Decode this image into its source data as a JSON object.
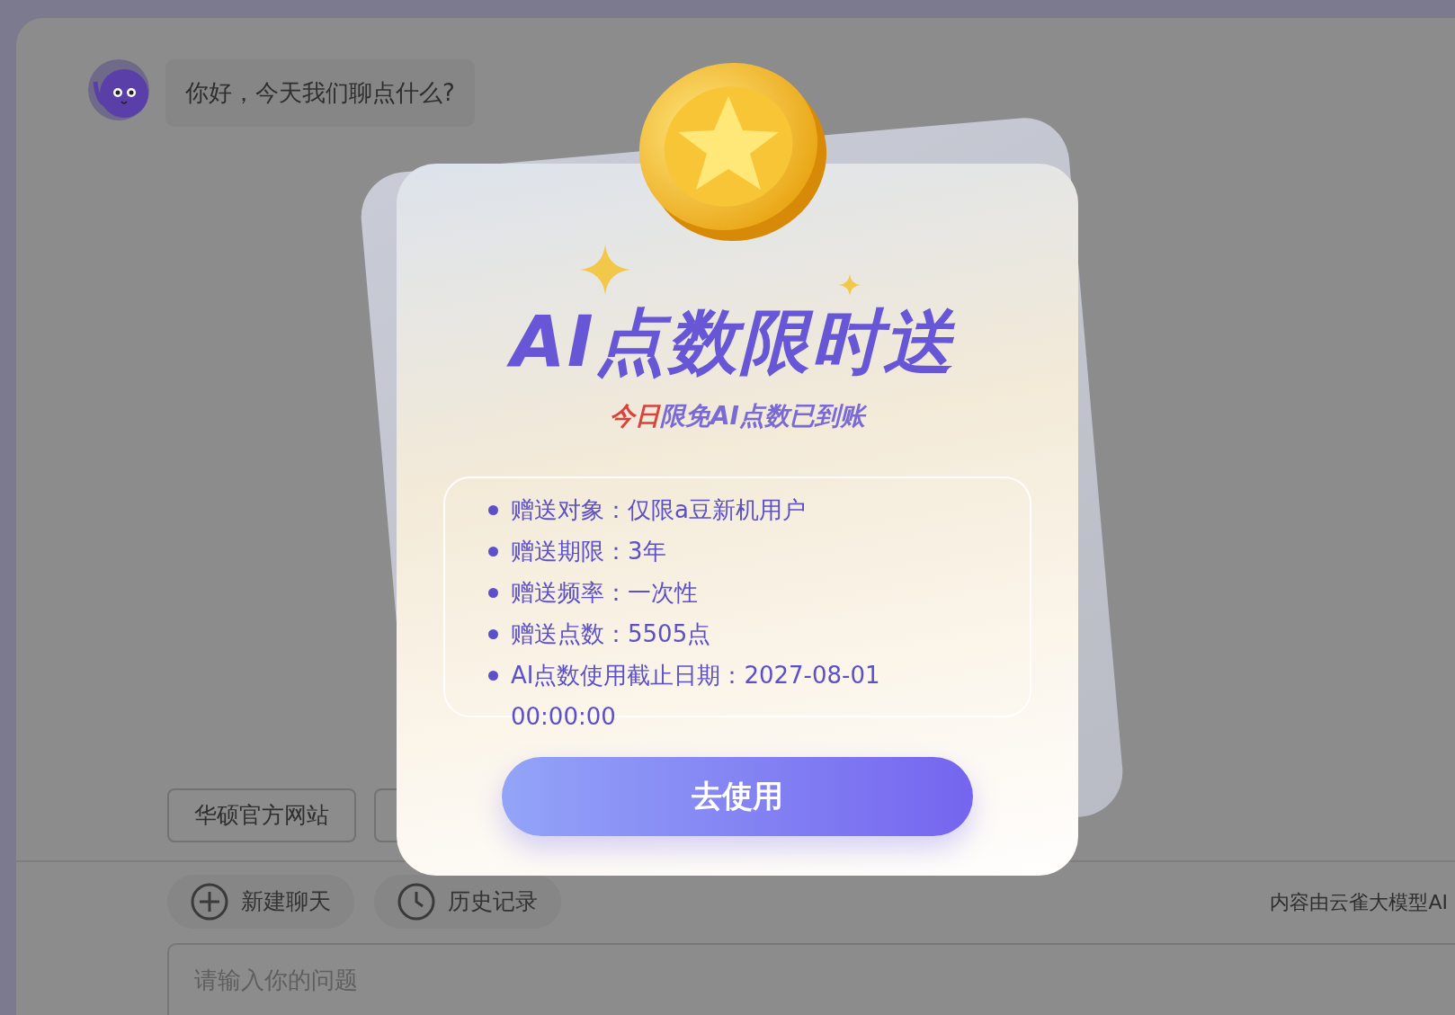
{
  "chat": {
    "messages": [
      {
        "text": "你好，今天我们聊点什么?"
      }
    ]
  },
  "shortcuts": [
    {
      "kind": "labeled",
      "label": "华硕官方网站"
    },
    {
      "kind": "covered"
    }
  ],
  "tools": [
    {
      "kind": "new",
      "label": "新建聊天"
    },
    {
      "kind": "history",
      "label": "历史记录"
    }
  ],
  "disclaimer": "内容由云雀大模型AI",
  "input": {
    "placeholder": "请输入你的问题"
  },
  "promo": {
    "title": "AI点数限时送",
    "subtitle": {
      "highlight": "今日",
      "text": "限免AI点数已到账"
    },
    "details": [
      "赠送对象：仅限a豆新机用户",
      "赠送期限：3年",
      "赠送频率：一次性",
      "赠送点数：5505点",
      "AI点数使用截止日期：2027-08-01 00:00:00"
    ],
    "button": "去使用"
  }
}
